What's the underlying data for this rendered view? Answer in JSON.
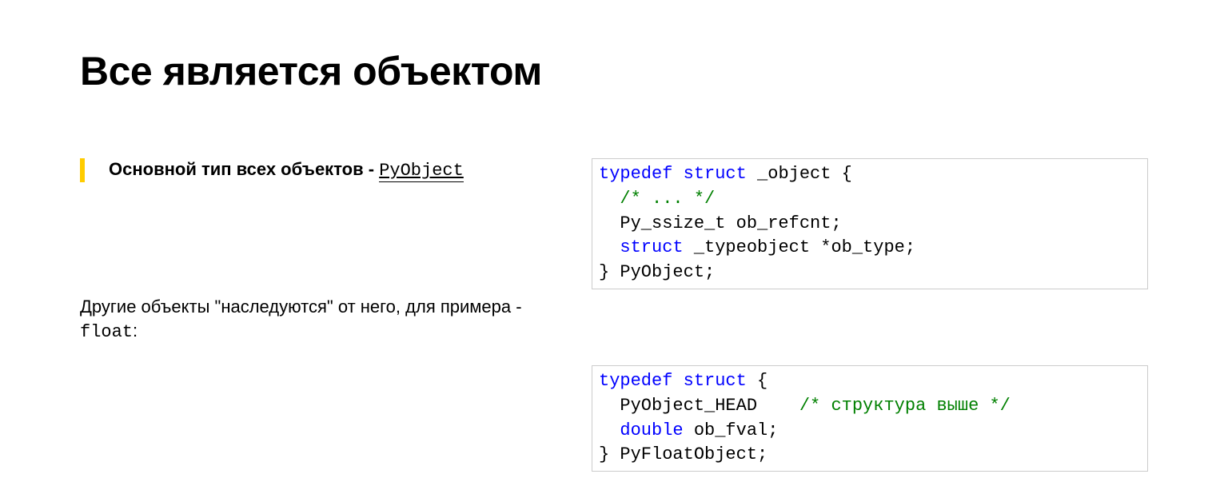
{
  "title": "Все является объектом",
  "callout": {
    "text_before_link": "Основной тип всех объектов - ",
    "link_text": "PyObject"
  },
  "para": {
    "text_before_mono": "Другие объекты \"наследуются\" от него, для примера - ",
    "mono_text": "float",
    "text_after_mono": ":"
  },
  "code1": {
    "tokens": [
      {
        "t": "typedef",
        "c": "kw"
      },
      {
        "t": " ",
        "c": ""
      },
      {
        "t": "struct",
        "c": "kw"
      },
      {
        "t": " _object {\n  ",
        "c": ""
      },
      {
        "t": "/* ... */",
        "c": "cm"
      },
      {
        "t": "\n  Py_ssize_t ob_refcnt;\n  ",
        "c": ""
      },
      {
        "t": "struct",
        "c": "kw"
      },
      {
        "t": " _typeobject *ob_type;\n} PyObject;",
        "c": ""
      }
    ]
  },
  "code2": {
    "tokens": [
      {
        "t": "typedef",
        "c": "kw"
      },
      {
        "t": " ",
        "c": ""
      },
      {
        "t": "struct",
        "c": "kw"
      },
      {
        "t": " {\n  PyObject_HEAD    ",
        "c": ""
      },
      {
        "t": "/* структура выше */",
        "c": "cm"
      },
      {
        "t": "\n  ",
        "c": ""
      },
      {
        "t": "double",
        "c": "kw"
      },
      {
        "t": " ob_fval;\n} PyFloatObject;",
        "c": ""
      }
    ]
  }
}
